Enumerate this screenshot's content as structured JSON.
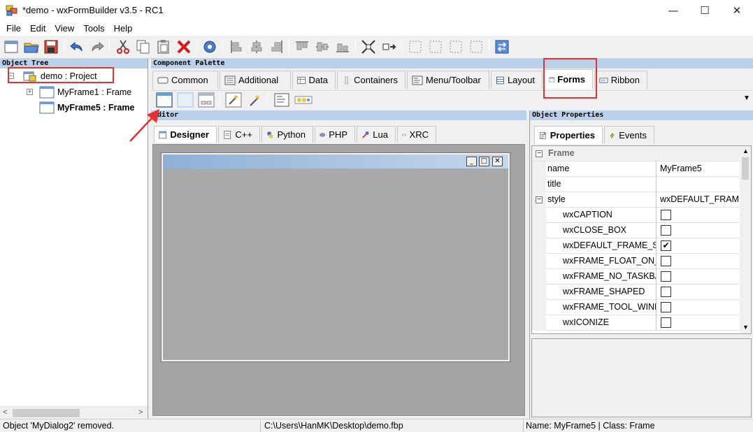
{
  "window": {
    "title": "*demo - wxFormBuilder v3.5 - RC1",
    "minimize_glyph": "—",
    "maximize_glyph": "☐",
    "close_glyph": "✕"
  },
  "menu": {
    "items": [
      {
        "label": "File"
      },
      {
        "label": "Edit"
      },
      {
        "label": "View"
      },
      {
        "label": "Tools"
      },
      {
        "label": "Help"
      }
    ]
  },
  "panels": {
    "object_tree_title": "Object Tree",
    "palette_title": "Component Palette",
    "editor_title": "Editor",
    "properties_title": "Object Properties"
  },
  "tree": {
    "items": [
      {
        "label": "demo : Project"
      },
      {
        "label": "MyFrame1 : Frame"
      },
      {
        "label": "MyFrame5 : Frame"
      }
    ]
  },
  "palette": {
    "tabs": [
      {
        "label": "Common"
      },
      {
        "label": "Additional"
      },
      {
        "label": "Data"
      },
      {
        "label": "Containers"
      },
      {
        "label": "Menu/Toolbar"
      },
      {
        "label": "Layout"
      },
      {
        "label": "Forms"
      },
      {
        "label": "Ribbon"
      }
    ],
    "active_tab": "Forms"
  },
  "editor": {
    "tabs": [
      {
        "label": "Designer"
      },
      {
        "label": "C++"
      },
      {
        "label": "Python"
      },
      {
        "label": "PHP"
      },
      {
        "label": "Lua"
      },
      {
        "label": "XRC"
      }
    ],
    "active_tab": "Designer",
    "frame_caption_buttons": [
      "_",
      "□",
      "✕"
    ]
  },
  "properties": {
    "tabs": [
      {
        "label": "Properties"
      },
      {
        "label": "Events"
      }
    ],
    "category": "Frame",
    "rows": [
      {
        "name": "name",
        "value": "MyFrame5"
      },
      {
        "name": "title",
        "value": ""
      },
      {
        "name": "style",
        "value": "wxDEFAULT_FRAME_"
      }
    ],
    "style_flags": [
      {
        "name": "wxCAPTION",
        "checked": false,
        "mark": ""
      },
      {
        "name": "wxCLOSE_BOX",
        "checked": false,
        "mark": ""
      },
      {
        "name": "wxDEFAULT_FRAME_ST",
        "checked": true,
        "mark": "✔"
      },
      {
        "name": "wxFRAME_FLOAT_ON_P",
        "checked": false,
        "mark": ""
      },
      {
        "name": "wxFRAME_NO_TASKBA",
        "checked": false,
        "mark": ""
      },
      {
        "name": "wxFRAME_SHAPED",
        "checked": false,
        "mark": ""
      },
      {
        "name": "wxFRAME_TOOL_WIND",
        "checked": false,
        "mark": ""
      },
      {
        "name": "wxICONIZE",
        "checked": false,
        "mark": ""
      }
    ]
  },
  "status": {
    "message": "Object 'MyDialog2' removed.",
    "path": "C:\\Users\\HanMK\\Desktop\\demo.fbp",
    "selection": "Name: MyFrame5 | Class: Frame"
  },
  "colors": {
    "panel_header": "#b9d1ea",
    "annotation_red": "#e23232",
    "design_bg": "#a3a3a3"
  }
}
